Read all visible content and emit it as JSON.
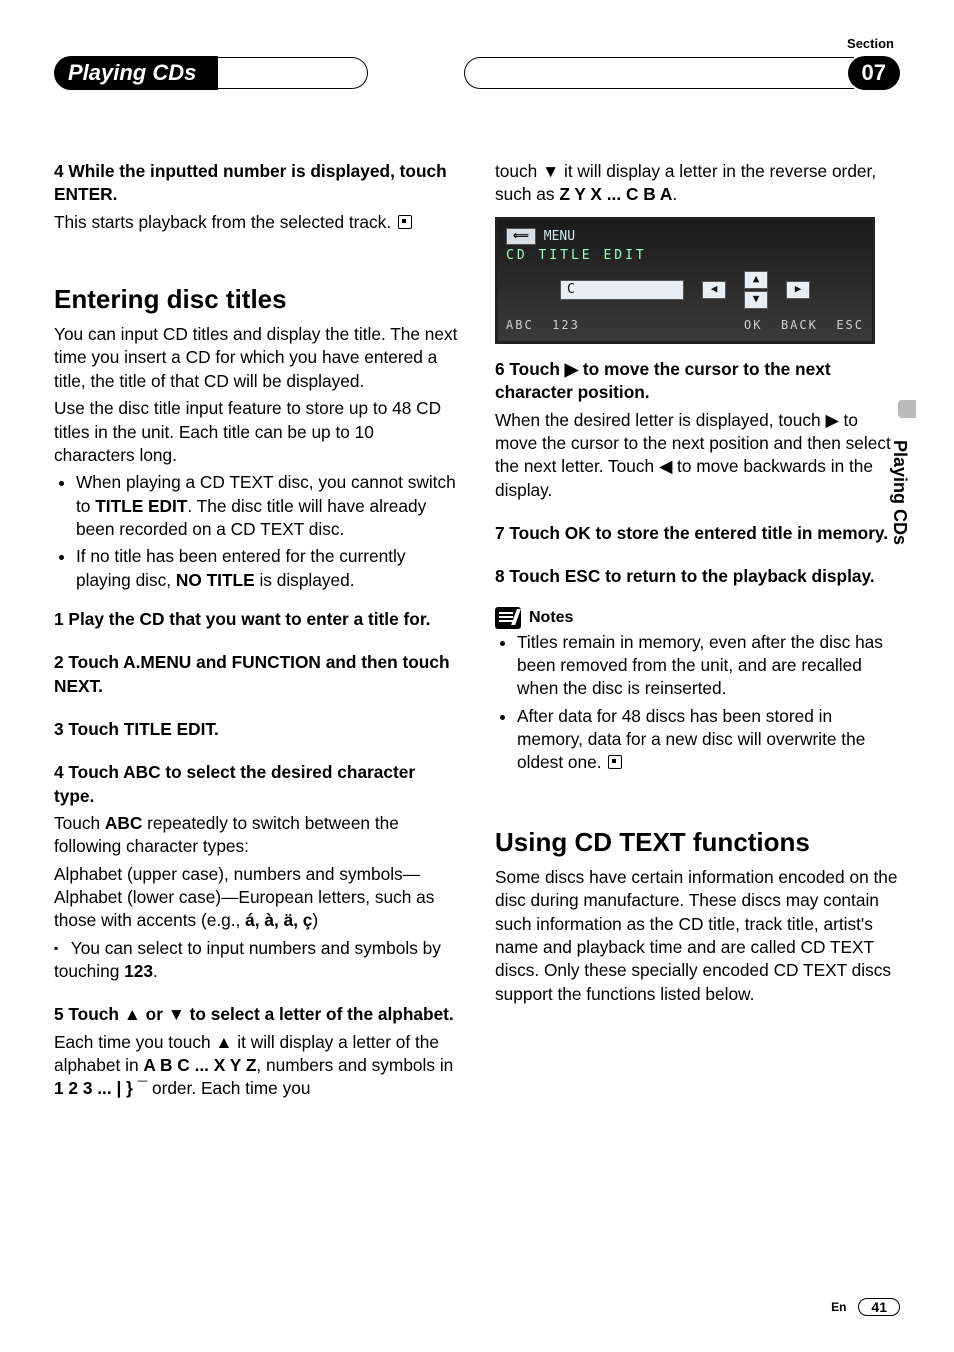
{
  "header": {
    "section_label": "Section",
    "chapter_title": "Playing CDs",
    "chapter_number": "07",
    "side_tab": "Playing CDs"
  },
  "footer": {
    "lang": "En",
    "page": "41"
  },
  "left": {
    "topstep_a": "4   While the inputted number is displayed, touch ENTER.",
    "topstep_b": "This starts playback from the selected track.",
    "h1": "Entering disc titles",
    "p1": "You can input CD titles and display the title. The next time you insert a CD for which you have entered a title, the title of that CD will be displayed.",
    "p2": "Use the disc title input feature to store up to 48 CD titles in the unit. Each title can be up to 10 characters long.",
    "bul1": "When playing a CD TEXT disc, you cannot switch to ",
    "bul1b": "TITLE EDIT",
    "bul1c": ". The disc title will have already been recorded on a CD TEXT disc.",
    "bul2a": "If no title has been entered for the currently playing disc, ",
    "bul2b": "NO TITLE",
    "bul2c": " is displayed.",
    "s1": "1   Play the CD that you want to enter a title for.",
    "s2": "2   Touch A.MENU and FUNCTION and then touch NEXT.",
    "s3": "3   Touch TITLE EDIT.",
    "s4": "4   Touch ABC to select the desired character type.",
    "s4b_a": "Touch ",
    "s4b_b": "ABC",
    "s4b_c": " repeatedly to switch between the following character types:",
    "s4c": "Alphabet (upper case), numbers and symbols—Alphabet (lower case)—European letters, such as those with accents (e.g., ",
    "s4c_b": "á, à, ä, ç",
    "s4c_c": ")",
    "s4d_a": "You can select to input numbers and symbols by touching ",
    "s4d_b": "123",
    "s4d_c": ".",
    "s5": "5   Touch ▲ or ▼ to select a letter of the alphabet.",
    "s5b_a": "Each time you touch ▲ it will display a letter of the alphabet in ",
    "s5b_b": "A B C ... X Y Z",
    "s5b_c": ", numbers and symbols in ",
    "s5b_d": "1 2 3 ... | } ¯",
    "s5b_e": " order. Each time you"
  },
  "right": {
    "cont_a": "touch ▼ it will display a letter in the reverse order, such as ",
    "cont_b": "Z Y X ... C B A",
    "cont_c": ".",
    "shot": {
      "menu": "MENU",
      "title": "CD  TITLE EDIT",
      "field": "C",
      "abc": "ABC",
      "num": "123",
      "ok": "OK",
      "back": "BACK",
      "esc": "ESC"
    },
    "s6": "6   Touch ▶ to move the cursor to the next character position.",
    "s6b": "When the desired letter is displayed, touch ▶ to move the cursor to the next position and then select the next letter. Touch ◀ to move backwards in the display.",
    "s7": "7   Touch OK to store the entered title in memory.",
    "s8": "8   Touch ESC to return to the playback display.",
    "notes_label": "Notes",
    "note1": "Titles remain in memory, even after the disc has been removed from the unit, and are recalled when the disc is reinserted.",
    "note2": "After data for 48 discs has been stored in memory, data for a new disc will overwrite the oldest one.",
    "h2": "Using CD TEXT functions",
    "p2": "Some discs have certain information encoded on the disc during manufacture. These discs may contain such information as the CD title, track title, artist's name and playback time and are called CD TEXT discs. Only these specially encoded CD TEXT discs support the functions listed below."
  }
}
